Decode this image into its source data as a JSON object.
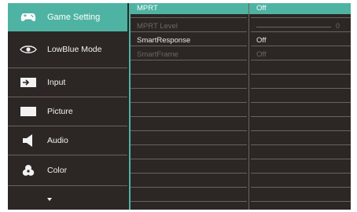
{
  "menu": {
    "items": [
      {
        "label": "Game Setting",
        "icon": "gamepad-icon",
        "active": true
      },
      {
        "label": "LowBlue Mode",
        "icon": "eye-icon",
        "active": false
      },
      {
        "label": "Input",
        "icon": "input-icon",
        "active": false
      },
      {
        "label": "Picture",
        "icon": "picture-icon",
        "active": false
      },
      {
        "label": "Audio",
        "icon": "speaker-icon",
        "active": false
      },
      {
        "label": "Color",
        "icon": "color-icon",
        "active": false
      }
    ],
    "more_icon": "chevron-down-icon"
  },
  "submenu": {
    "rows": [
      {
        "name": "MPRT",
        "value": "Off",
        "state": "active"
      },
      {
        "name": "MPRT Level",
        "value": "0",
        "state": "disabled",
        "type": "slider",
        "level": 0
      },
      {
        "name": "SmartResponse",
        "value": "Off",
        "state": "normal"
      },
      {
        "name": "SmartFrame",
        "value": "Off",
        "state": "disabled"
      }
    ]
  },
  "colors": {
    "accent": "#4fb3a3",
    "panel": "#2c2724",
    "line": "#6b6360",
    "disabled_text": "#6e6763"
  }
}
